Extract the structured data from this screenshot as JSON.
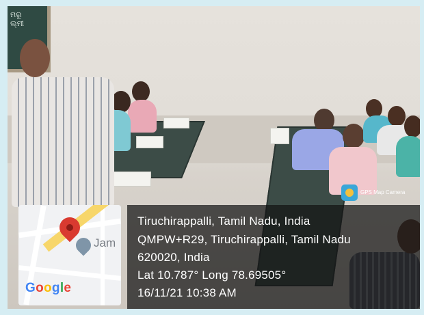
{
  "board_text": [
    "ମରୂ",
    "ଲ୍ମୀ"
  ],
  "gps_camera_label": "GPS Map Camera",
  "map": {
    "poi_label": "Jam",
    "logo_text": "Google"
  },
  "location": {
    "line1": "Tiruchirappalli, Tamil Nadu, India",
    "line2": "QMPW+R29, Tiruchirappalli, Tamil Nadu",
    "line3": "620020, India",
    "line4": "Lat 10.787° Long 78.69505°",
    "line5": "16/11/21 10:38 AM"
  },
  "colors": {
    "overlay": "#141414",
    "pin": "#d93a30",
    "google_blue": "#4285f4",
    "google_red": "#ea4335",
    "google_yellow": "#fbbc05",
    "google_green": "#34a853"
  }
}
